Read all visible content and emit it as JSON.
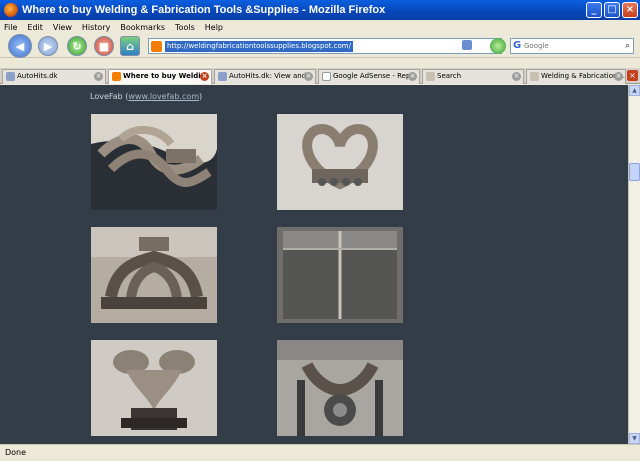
{
  "window": {
    "title": "Where to buy Welding & Fabrication Tools &Supplies - Mozilla Firefox"
  },
  "menu": [
    "File",
    "Edit",
    "View",
    "History",
    "Bookmarks",
    "Tools",
    "Help"
  ],
  "toolbar": {
    "url": "http://weldingfabricationtoolssupplies.blogspot.com/",
    "search_placeholder": "Google"
  },
  "tabs": [
    {
      "label": "AutoHits.dk",
      "active": false
    },
    {
      "label": "Where to buy Weldi...",
      "active": true
    },
    {
      "label": "AutoHits.dk: View and...",
      "active": false
    },
    {
      "label": "Google AdSense - Rep...",
      "active": false
    },
    {
      "label": "Search",
      "active": false
    },
    {
      "label": "Welding & Fabrication ...",
      "active": false
    }
  ],
  "content": {
    "source_name": "LoveFab",
    "source_link": "www.lovefab.com"
  },
  "status": "Done"
}
